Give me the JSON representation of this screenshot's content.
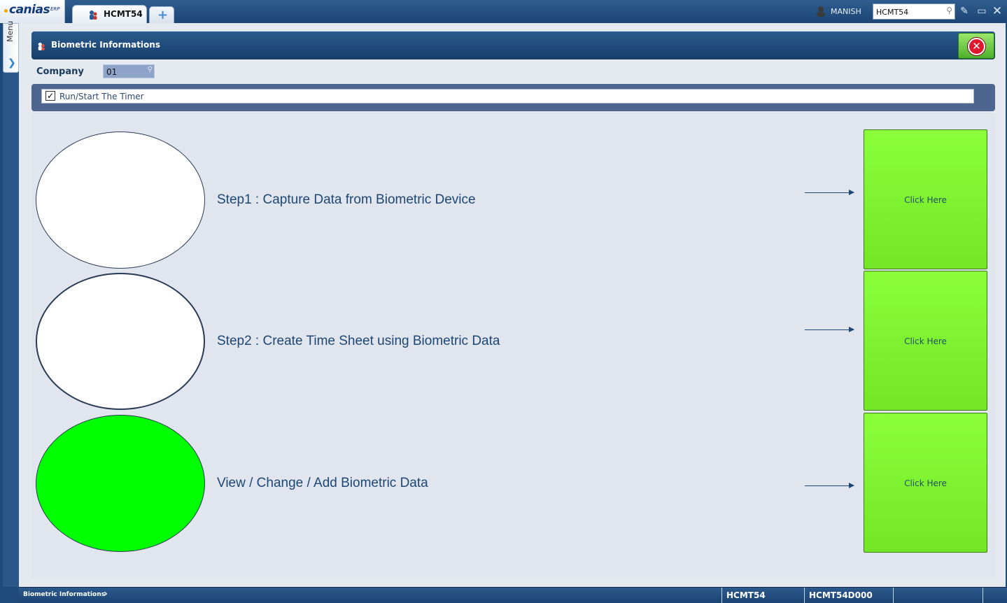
{
  "app": {
    "logo_name": "canias",
    "logo_suffix": "ERP",
    "tabs": [
      {
        "label": "HCMT54"
      }
    ],
    "add_tab_symbol": "+",
    "user_name": "MANISH",
    "search_value": "HCMT54"
  },
  "menu": {
    "label": "Menu"
  },
  "form": {
    "title": "Biometric Informations",
    "company_label": "Company",
    "company_value": "01",
    "timer_checked": true,
    "timer_label": "Run/Start The Timer"
  },
  "steps": [
    {
      "text": "Step1 : Capture Data from Biometric Device",
      "button_label": "Click Here",
      "indicator_color": "#ffffff"
    },
    {
      "text": "Step2 : Create Time Sheet using Biometric Data",
      "button_label": "Click Here",
      "indicator_color": "#ffffff"
    },
    {
      "text": "View / Change / Add Biometric Data",
      "button_label": "Click Here",
      "indicator_color": "#00ff00"
    }
  ],
  "status": {
    "breadcrumb": "Biometric Informations",
    "cells": [
      "HCMT54",
      "HCMT54D000",
      ""
    ]
  },
  "colors": {
    "accent_green": "#7df02e",
    "title_bar": "#1d4a7a",
    "text_blue": "#1d4774"
  }
}
